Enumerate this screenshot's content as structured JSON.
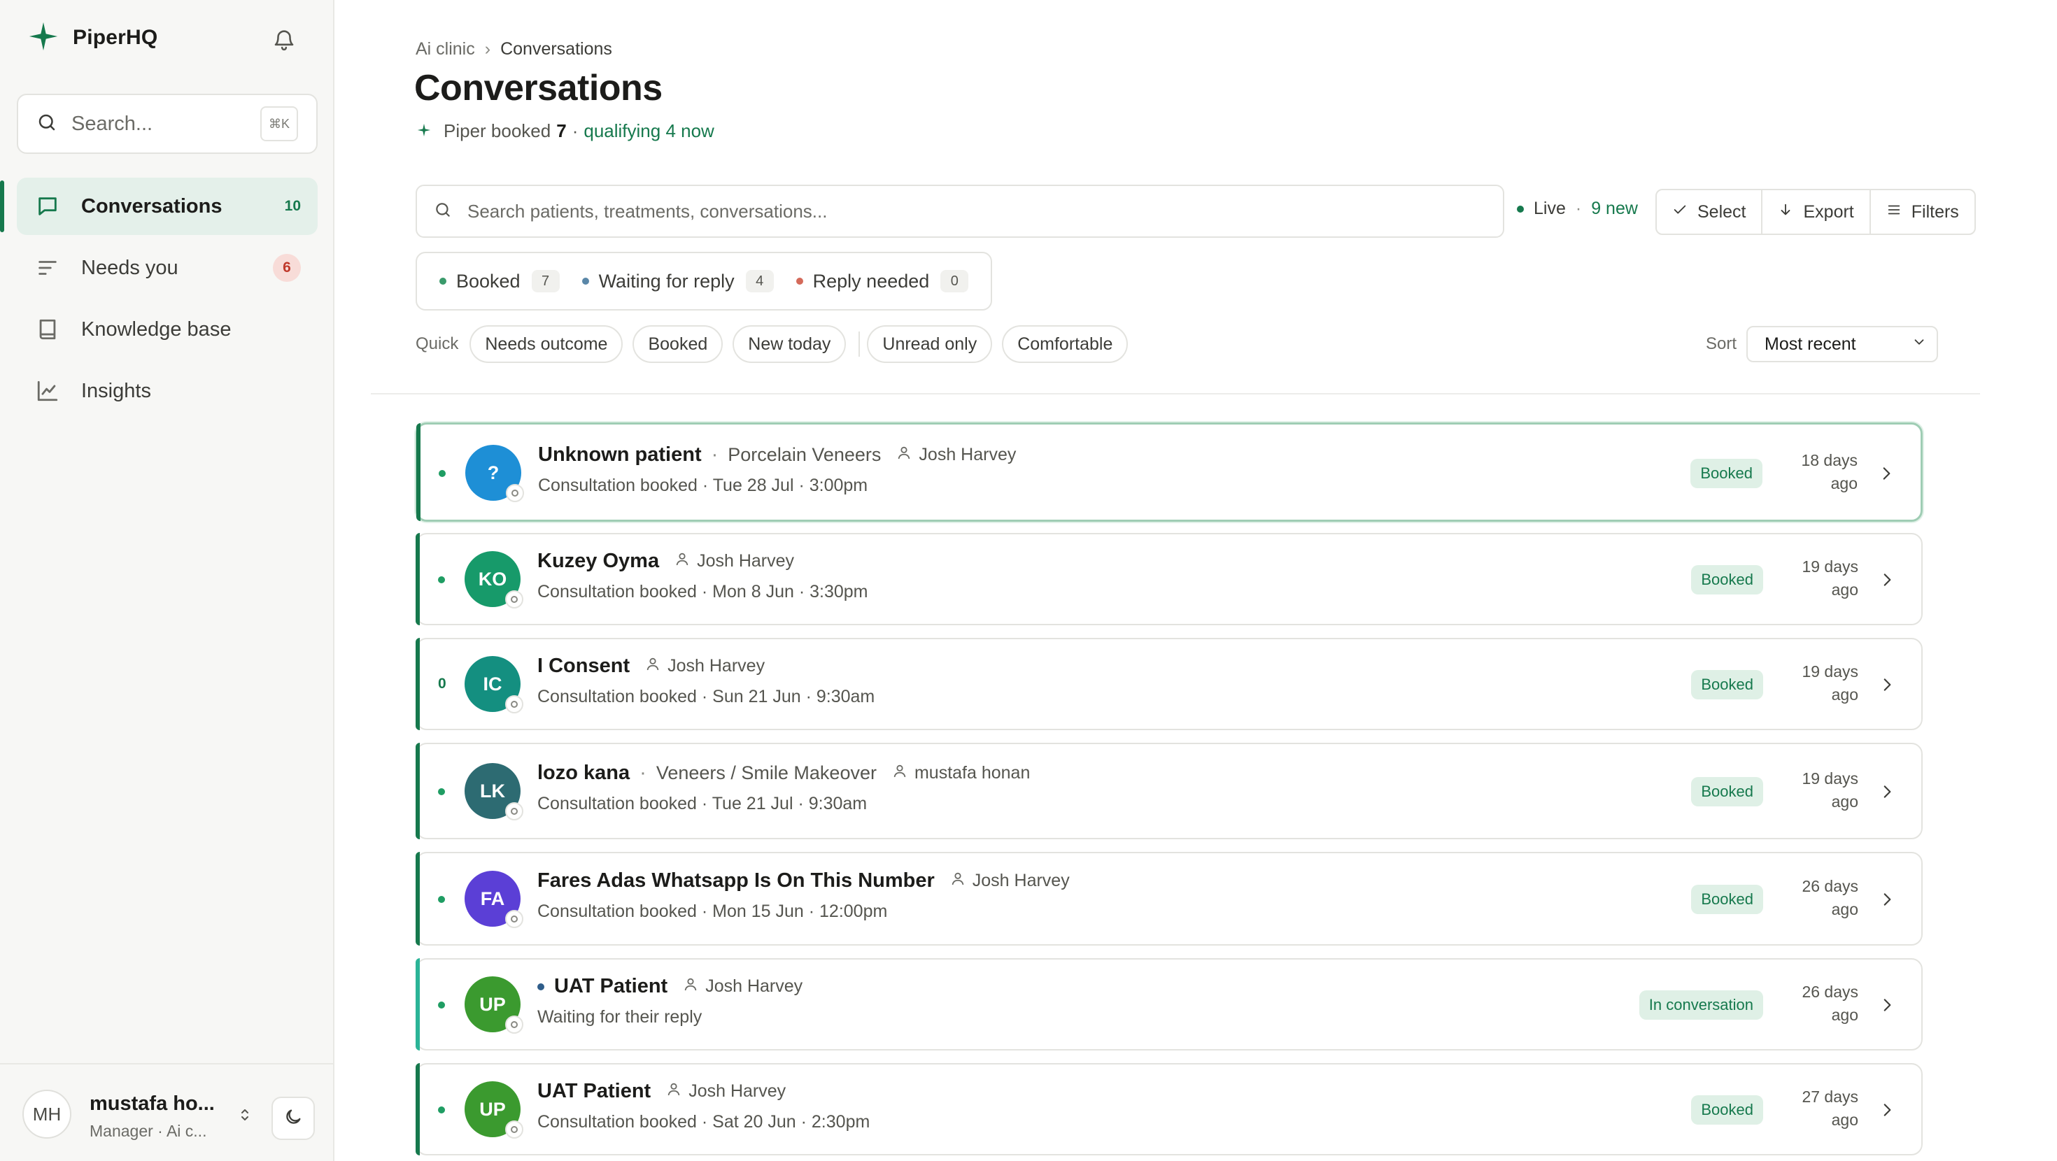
{
  "app": {
    "brand": "PiperHQ"
  },
  "sidebar": {
    "search_placeholder": "Search...",
    "search_shortcut": "⌘K",
    "items": [
      {
        "label": "Conversations",
        "count": "10",
        "icon": "chat-bubble-icon",
        "active": true
      },
      {
        "label": "Needs you",
        "count": "6",
        "icon": "lines-icon"
      },
      {
        "label": "Knowledge base",
        "icon": "book-icon"
      },
      {
        "label": "Insights",
        "icon": "chart-icon"
      }
    ],
    "profile": {
      "initials": "MH",
      "name": "mustafa ho...",
      "role": "Manager · Ai c..."
    }
  },
  "header": {
    "breadcrumb": [
      "Ai clinic",
      "Conversations"
    ],
    "breadcrumb_sep": "›",
    "title": "Conversations",
    "sub_prefix": "Piper booked",
    "sub_booked": "7",
    "sub_mid": "·",
    "sub_qualifying": "qualifying 4 now"
  },
  "toolbar": {
    "search_placeholder": "Search patients, treatments, conversations...",
    "live_label": "Live",
    "live_sep": "·",
    "new_label": "9 new",
    "select_label": "Select",
    "export_label": "Export",
    "filters_label": "Filters"
  },
  "tabs": [
    {
      "label": "Booked",
      "count": "7",
      "color": "#3a9a6b"
    },
    {
      "label": "Waiting for reply",
      "count": "4",
      "color": "#5a87a8"
    },
    {
      "label": "Reply needed",
      "count": "0",
      "color": "#d46a5a"
    }
  ],
  "quick": {
    "label": "Quick",
    "chips_a": [
      "Needs outcome",
      "Booked",
      "New today"
    ],
    "chips_b": [
      "Unread only",
      "Comfortable"
    ]
  },
  "sort": {
    "label": "Sort",
    "value": "Most recent"
  },
  "conversations": [
    {
      "initials": "?",
      "name": "Unknown patient",
      "treatment": "Porcelain Veneers",
      "assignee": "Josh Harvey",
      "subtitle": "Consultation booked · Tue 28 Jul · 3:00pm",
      "status": "Booked",
      "time_a": "18 days",
      "time_b": "ago",
      "color": "#1e8fd6",
      "indicator": "dot"
    },
    {
      "initials": "KO",
      "name": "Kuzey Oyma",
      "treatment": "",
      "assignee": "Josh Harvey",
      "subtitle": "Consultation booked · Mon 8 Jun · 3:30pm",
      "status": "Booked",
      "time_a": "19 days",
      "time_b": "ago",
      "color": "#179a6a",
      "indicator": "dot"
    },
    {
      "initials": "IC",
      "name": "I Consent",
      "treatment": "",
      "assignee": "Josh Harvey",
      "subtitle": "Consultation booked · Sun 21 Jun · 9:30am",
      "status": "Booked",
      "time_a": "19 days",
      "time_b": "ago",
      "color": "#148f80",
      "indicator": "0"
    },
    {
      "initials": "LK",
      "name": "lozo kana",
      "treatment": "Veneers / Smile Makeover",
      "assignee": "mustafa honan",
      "subtitle": "Consultation booked · Tue 21 Jul · 9:30am",
      "status": "Booked",
      "time_a": "19 days",
      "time_b": "ago",
      "color": "#2d6b72",
      "indicator": "dot"
    },
    {
      "initials": "FA",
      "name": "Fares Adas Whatsapp Is On This Number",
      "treatment": "",
      "assignee": "Josh Harvey",
      "subtitle": "Consultation booked · Mon 15 Jun · 12:00pm",
      "status": "Booked",
      "time_a": "26 days",
      "time_b": "ago",
      "color": "#5b3fd6",
      "indicator": "dot"
    },
    {
      "initials": "UP",
      "name": "UAT Patient",
      "treatment": "",
      "assignee": "Josh Harvey",
      "subtitle": "Waiting for their reply",
      "status": "In conversation",
      "time_a": "26 days",
      "time_b": "ago",
      "color": "#3b9a2f",
      "indicator": "dot",
      "unread": true
    },
    {
      "initials": "UP",
      "name": "UAT Patient",
      "treatment": "",
      "assignee": "Josh Harvey",
      "subtitle": "Consultation booked · Sat 20 Jun · 2:30pm",
      "status": "Booked",
      "time_a": "27 days",
      "time_b": "ago",
      "color": "#3b9a2f",
      "indicator": "dot"
    }
  ]
}
